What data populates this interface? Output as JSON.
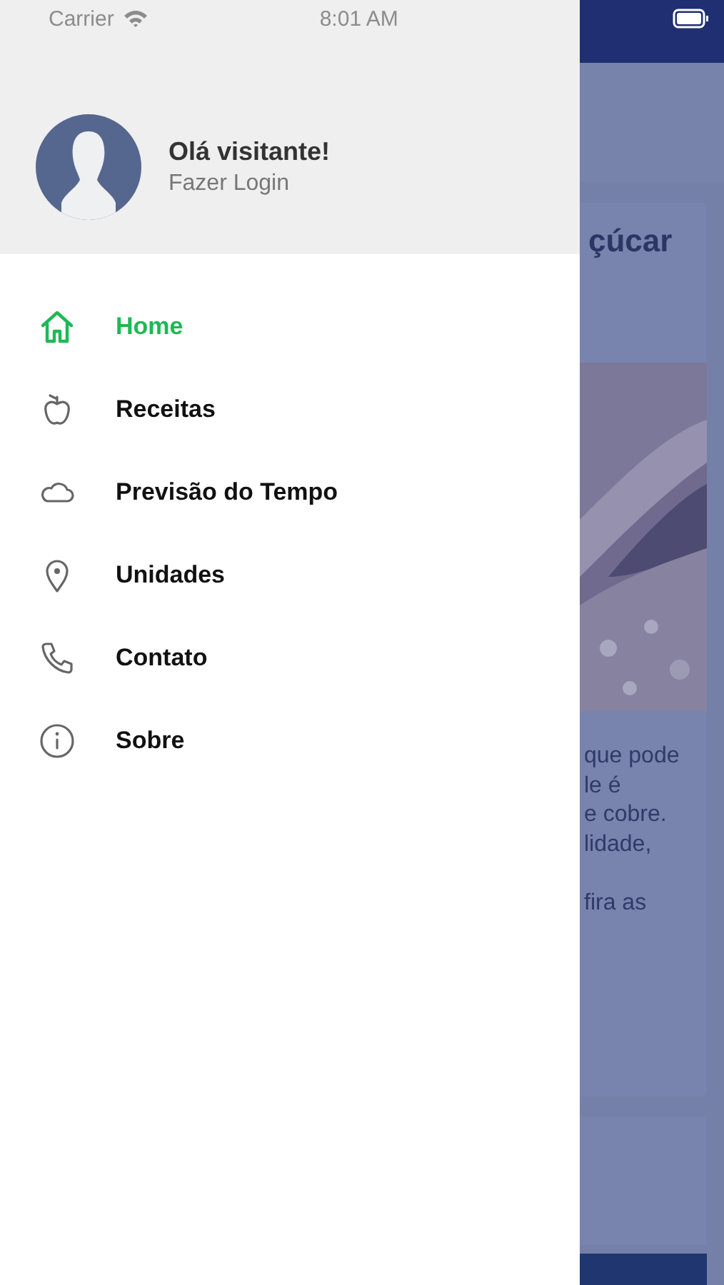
{
  "status_bar": {
    "carrier": "Carrier",
    "time": "8:01 AM"
  },
  "drawer": {
    "greeting": "Olá visitante!",
    "login": "Fazer Login",
    "items": [
      {
        "kind": "home",
        "label": "Home",
        "selected": true
      },
      {
        "kind": "apple",
        "label": "Receitas",
        "selected": false
      },
      {
        "kind": "cloud",
        "label": "Previsão do Tempo",
        "selected": false
      },
      {
        "kind": "pin",
        "label": "Unidades",
        "selected": false
      },
      {
        "kind": "phone",
        "label": "Contato",
        "selected": false
      },
      {
        "kind": "info",
        "label": "Sobre",
        "selected": false
      }
    ]
  },
  "background": {
    "card_title": "çúcar",
    "card_paragraphs": [
      [
        "que pode",
        "le é",
        "e cobre.",
        "lidade,"
      ],
      [
        "fira as"
      ]
    ]
  }
}
